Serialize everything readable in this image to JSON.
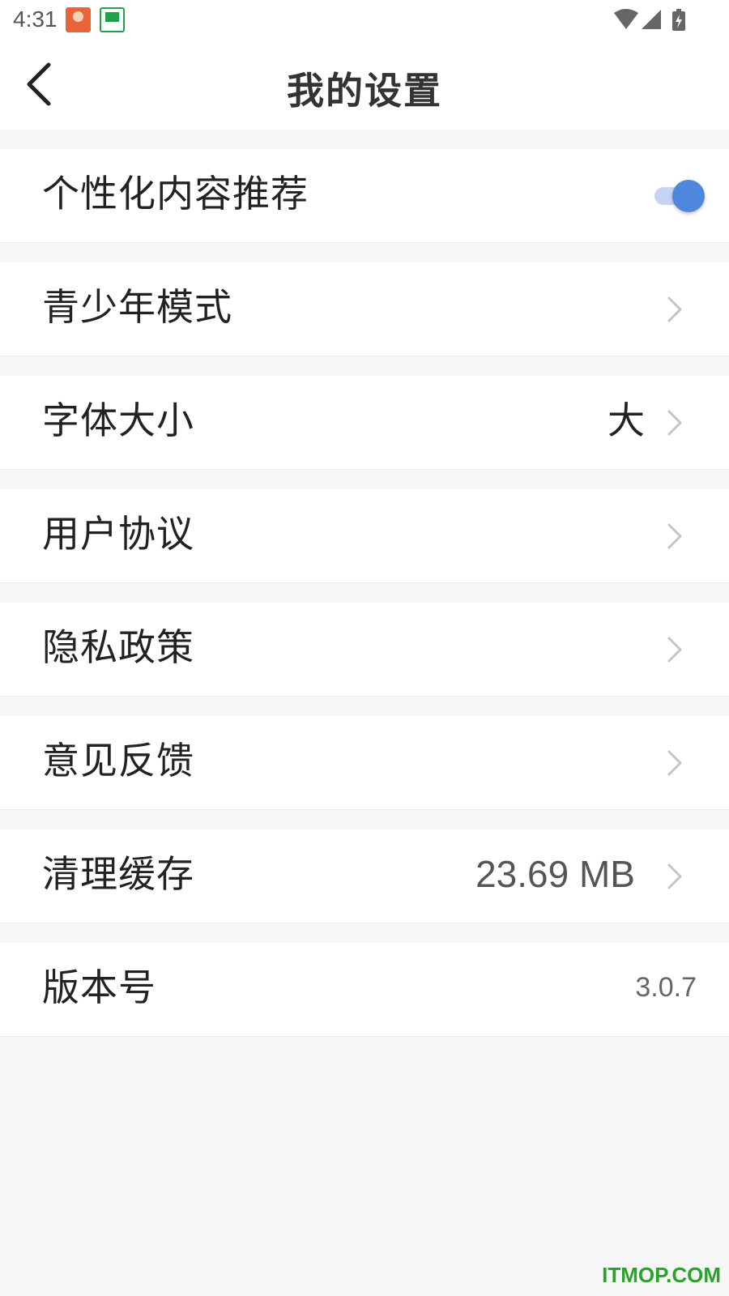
{
  "status_bar": {
    "time": "4:31",
    "notification_icons": [
      "game-app-icon",
      "drone-app-icon"
    ],
    "system_icons": [
      "wifi-icon",
      "signal-icon",
      "battery-charging-icon"
    ]
  },
  "header": {
    "title": "我的设置",
    "back_icon": "back-arrow-icon"
  },
  "settings": {
    "personalized": {
      "label": "个性化内容推荐",
      "enabled": true
    },
    "teen_mode": {
      "label": "青少年模式"
    },
    "font_size": {
      "label": "字体大小",
      "value": "大"
    },
    "user_agreement": {
      "label": "用户协议"
    },
    "privacy_policy": {
      "label": "隐私政策"
    },
    "feedback": {
      "label": "意见反馈"
    },
    "clear_cache": {
      "label": "清理缓存",
      "value": "23.69 MB"
    },
    "version": {
      "label": "版本号",
      "value": "3.0.7"
    }
  },
  "colors": {
    "accent": "#4f87dd",
    "toggle_track": "#c7d4f3",
    "background": "#f6f6f6",
    "watermark": "#2ba32b"
  },
  "watermark": "ITMOP.COM"
}
